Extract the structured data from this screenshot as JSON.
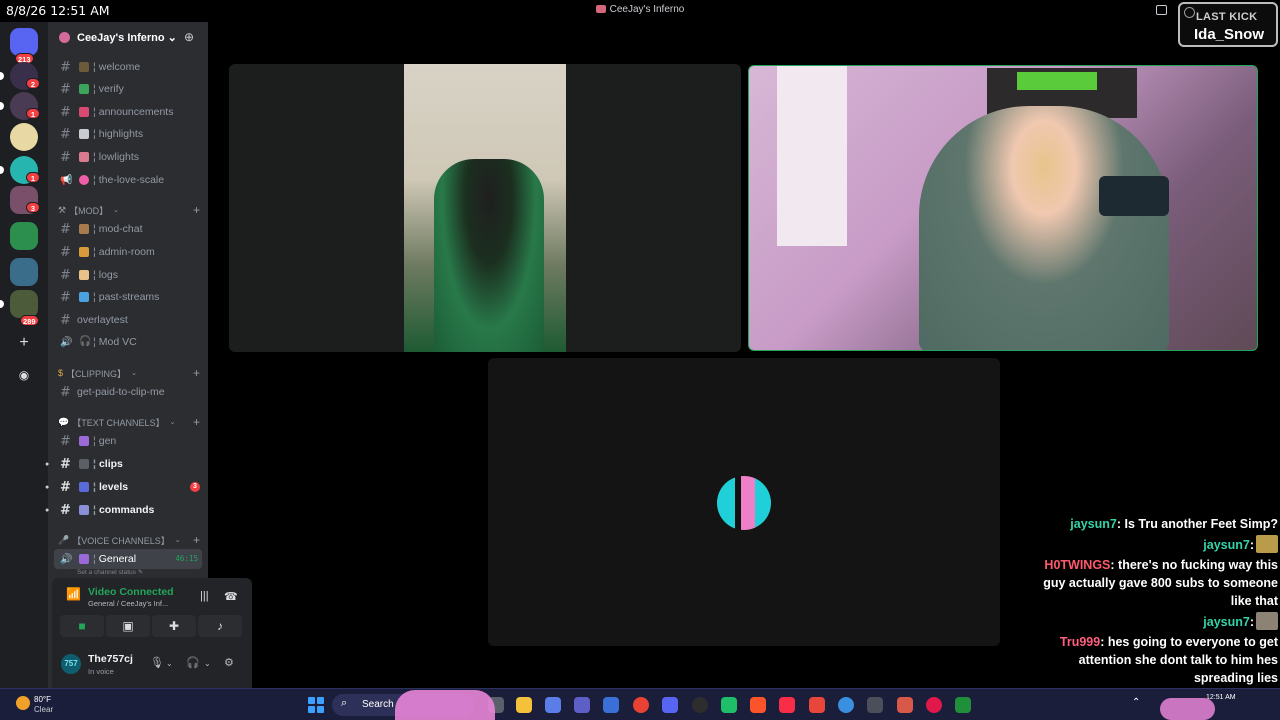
{
  "overlay": {
    "timestamp": "8/8/26 12:51 AM",
    "last_kick_label": "LAST KICK",
    "last_kick_name": "Ida_Snow"
  },
  "window": {
    "title": "CeeJay's Inferno"
  },
  "rail": {
    "badge_top": "213",
    "server_badges": [
      "2",
      "1",
      "1",
      "3",
      "289"
    ]
  },
  "server": {
    "name": "CeeJay's Inferno"
  },
  "channels": [
    {
      "name": "welcome",
      "bold": false
    },
    {
      "name": "verify",
      "bold": false
    },
    {
      "name": "announcements",
      "bold": false
    },
    {
      "name": "highlights",
      "bold": false
    },
    {
      "name": "lowlights",
      "bold": false
    },
    {
      "name": "the-love-scale",
      "bold": false
    }
  ],
  "categories": {
    "mod": "【MOD】",
    "clipping": "【CLIPPING】",
    "text": "【TEXT CHANNELS】",
    "voice": "【VOICE CHANNELS】"
  },
  "mod_channels": [
    {
      "name": "mod-chat"
    },
    {
      "name": "admin-room"
    },
    {
      "name": "logs"
    },
    {
      "name": "past-streams"
    },
    {
      "name": "overlaytest"
    },
    {
      "name": "Mod VC"
    }
  ],
  "clipping_channels": [
    {
      "name": "get-paid-to-clip-me"
    }
  ],
  "text_channels": [
    {
      "name": "gen"
    },
    {
      "name": "clips"
    },
    {
      "name": "levels",
      "badge": "3"
    },
    {
      "name": "commands"
    }
  ],
  "voice_channels": [
    {
      "name": "General",
      "timer": "46:15",
      "status": "Set a channel status"
    }
  ],
  "voice_panel": {
    "title": "Video Connected",
    "subtitle": "General / CeeJay's Inf..."
  },
  "user": {
    "name": "The757cj",
    "status": "In voice",
    "avatar_text": "757"
  },
  "chat": [
    {
      "user": "jaysun7",
      "text": ": Is Tru another Feet Simp?",
      "style": "u1",
      "emote": false
    },
    {
      "user": "jaysun7",
      "text": ":",
      "style": "u1",
      "emote": true
    },
    {
      "user": "H0TWINGS",
      "text": ": there's no fucking way this guy actually gave 800 subs to someone like that",
      "style": "u2",
      "emote": false
    },
    {
      "user": "jaysun7",
      "text": ":",
      "style": "u1",
      "emote": true
    },
    {
      "user": "Tru999",
      "text": ": hes going to everyone to get attention she dont talk to him hes spreading lies",
      "style": "u3",
      "emote": false
    }
  ],
  "taskbar": {
    "temperature": "80°F",
    "condition": "Clear",
    "search_label": "Search",
    "clock": "12:51 AM"
  },
  "colors": {
    "speaking_green": "#23a55a",
    "mention_red": "#f23f42",
    "sidebar_bg": "#2b2d31",
    "rail_bg": "#1e1f22"
  }
}
